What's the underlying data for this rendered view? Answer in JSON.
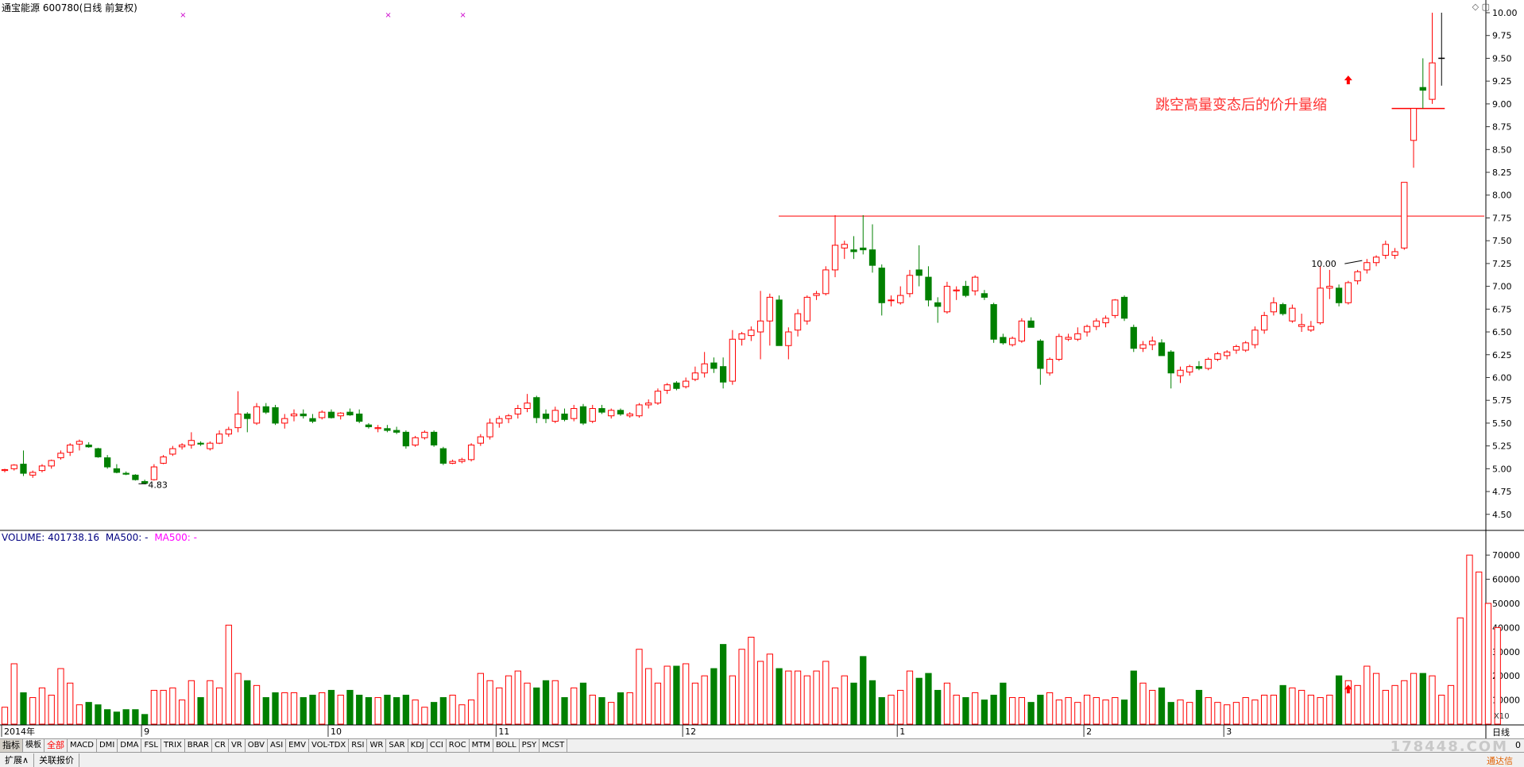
{
  "header": {
    "stock_title": "通宝能源 600780(日线 前复权)",
    "corner_icons": "◇ ▢"
  },
  "volume_header": {
    "label": "VOLUME: 401738.16",
    "ma1": "MA500: -",
    "ma2": "MA500: -"
  },
  "annotation": {
    "text": "跳空高量变态后的价升量缩",
    "color": "#ff3333"
  },
  "colors": {
    "up": "#ff0000",
    "down": "#008000",
    "resistance_line": "#ff0000",
    "axis": "#333333",
    "grid_line": "#000000",
    "marker_x": "#cc00cc"
  },
  "chart_data": [
    {
      "type": "candlestick",
      "title": "",
      "price_axis": {
        "ticks": [
          "10.00",
          "9.75",
          "9.50",
          "9.25",
          "9.00",
          "8.75",
          "8.50",
          "8.25",
          "8.00",
          "7.75",
          "7.50",
          "7.25",
          "7.00",
          "6.75",
          "6.50",
          "6.25",
          "6.00",
          "5.75",
          "5.50",
          "5.25",
          "5.00",
          "4.75",
          "4.50"
        ],
        "range": [
          4.35,
          10.0
        ]
      },
      "x_labels": [
        "2014年",
        "9",
        "10",
        "11",
        "12",
        "1",
        "2",
        "3"
      ],
      "x_label_positions": [
        0,
        15,
        35,
        53,
        73,
        96,
        116,
        131
      ],
      "annotations": [
        {
          "type": "low",
          "label": "4.83",
          "index": 14
        },
        {
          "type": "high",
          "label": "10.00",
          "index": 146
        }
      ],
      "resistance_level": 7.77,
      "small_bar_level": 8.95,
      "up_arrows": [
        144
      ],
      "x_markers": [
        19,
        41,
        49
      ],
      "candles": [
        [
          4.98,
          5.0,
          4.96,
          4.99
        ],
        [
          5.0,
          5.05,
          4.98,
          5.04
        ],
        [
          5.05,
          5.2,
          4.92,
          4.95
        ],
        [
          4.93,
          4.98,
          4.9,
          4.96
        ],
        [
          4.98,
          5.05,
          4.96,
          5.03
        ],
        [
          5.03,
          5.1,
          5.0,
          5.09
        ],
        [
          5.12,
          5.2,
          5.1,
          5.17
        ],
        [
          5.18,
          5.28,
          5.14,
          5.26
        ],
        [
          5.27,
          5.32,
          5.2,
          5.3
        ],
        [
          5.26,
          5.29,
          5.23,
          5.24
        ],
        [
          5.22,
          5.23,
          5.12,
          5.13
        ],
        [
          5.12,
          5.15,
          5.0,
          5.02
        ],
        [
          5.0,
          5.05,
          4.95,
          4.96
        ],
        [
          4.95,
          4.97,
          4.93,
          4.94
        ],
        [
          4.93,
          4.94,
          4.87,
          4.88
        ],
        [
          4.86,
          4.88,
          4.83,
          4.84
        ],
        [
          4.88,
          5.05,
          4.87,
          5.02
        ],
        [
          5.06,
          5.15,
          5.05,
          5.13
        ],
        [
          5.16,
          5.25,
          5.14,
          5.22
        ],
        [
          5.24,
          5.28,
          5.21,
          5.26
        ],
        [
          5.26,
          5.4,
          5.22,
          5.31
        ],
        [
          5.28,
          5.3,
          5.25,
          5.27
        ],
        [
          5.22,
          5.3,
          5.2,
          5.28
        ],
        [
          5.28,
          5.42,
          5.27,
          5.38
        ],
        [
          5.38,
          5.46,
          5.35,
          5.43
        ],
        [
          5.45,
          5.85,
          5.4,
          5.6
        ],
        [
          5.6,
          5.62,
          5.4,
          5.55
        ],
        [
          5.5,
          5.72,
          5.48,
          5.68
        ],
        [
          5.68,
          5.72,
          5.6,
          5.62
        ],
        [
          5.67,
          5.7,
          5.48,
          5.5
        ],
        [
          5.5,
          5.6,
          5.44,
          5.55
        ],
        [
          5.58,
          5.65,
          5.52,
          5.6
        ],
        [
          5.6,
          5.65,
          5.55,
          5.58
        ],
        [
          5.55,
          5.6,
          5.5,
          5.52
        ],
        [
          5.56,
          5.64,
          5.54,
          5.62
        ],
        [
          5.62,
          5.65,
          5.55,
          5.56
        ],
        [
          5.58,
          5.62,
          5.54,
          5.61
        ],
        [
          5.62,
          5.66,
          5.58,
          5.59
        ],
        [
          5.6,
          5.65,
          5.5,
          5.52
        ],
        [
          5.48,
          5.5,
          5.44,
          5.46
        ],
        [
          5.44,
          5.48,
          5.4,
          5.45
        ],
        [
          5.44,
          5.48,
          5.4,
          5.42
        ],
        [
          5.42,
          5.46,
          5.38,
          5.4
        ],
        [
          5.4,
          5.42,
          5.22,
          5.25
        ],
        [
          5.26,
          5.36,
          5.24,
          5.34
        ],
        [
          5.34,
          5.42,
          5.32,
          5.4
        ],
        [
          5.4,
          5.42,
          5.24,
          5.26
        ],
        [
          5.22,
          5.24,
          5.04,
          5.06
        ],
        [
          5.06,
          5.1,
          5.05,
          5.08
        ],
        [
          5.08,
          5.12,
          5.06,
          5.1
        ],
        [
          5.1,
          5.28,
          5.08,
          5.26
        ],
        [
          5.28,
          5.38,
          5.25,
          5.35
        ],
        [
          5.35,
          5.55,
          5.32,
          5.5
        ],
        [
          5.5,
          5.58,
          5.45,
          5.55
        ],
        [
          5.55,
          5.6,
          5.5,
          5.58
        ],
        [
          5.6,
          5.7,
          5.55,
          5.66
        ],
        [
          5.66,
          5.82,
          5.62,
          5.72
        ],
        [
          5.78,
          5.8,
          5.5,
          5.56
        ],
        [
          5.6,
          5.65,
          5.5,
          5.55
        ],
        [
          5.52,
          5.68,
          5.5,
          5.64
        ],
        [
          5.6,
          5.66,
          5.52,
          5.54
        ],
        [
          5.55,
          5.7,
          5.52,
          5.66
        ],
        [
          5.68,
          5.71,
          5.48,
          5.5
        ],
        [
          5.52,
          5.7,
          5.5,
          5.66
        ],
        [
          5.66,
          5.7,
          5.6,
          5.62
        ],
        [
          5.58,
          5.66,
          5.55,
          5.64
        ],
        [
          5.64,
          5.66,
          5.58,
          5.6
        ],
        [
          5.58,
          5.62,
          5.56,
          5.6
        ],
        [
          5.58,
          5.72,
          5.56,
          5.7
        ],
        [
          5.7,
          5.76,
          5.66,
          5.72
        ],
        [
          5.72,
          5.88,
          5.7,
          5.85
        ],
        [
          5.86,
          5.94,
          5.82,
          5.92
        ],
        [
          5.94,
          5.96,
          5.86,
          5.88
        ],
        [
          5.9,
          6.0,
          5.88,
          5.96
        ],
        [
          5.98,
          6.12,
          5.96,
          6.05
        ],
        [
          6.05,
          6.28,
          6.0,
          6.15
        ],
        [
          6.16,
          6.22,
          6.05,
          6.1
        ],
        [
          6.12,
          6.22,
          5.88,
          5.95
        ],
        [
          5.96,
          6.52,
          5.92,
          6.42
        ],
        [
          6.42,
          6.5,
          6.35,
          6.48
        ],
        [
          6.46,
          6.56,
          6.4,
          6.52
        ],
        [
          6.5,
          6.95,
          6.2,
          6.62
        ],
        [
          6.62,
          6.92,
          6.35,
          6.88
        ],
        [
          6.85,
          6.9,
          6.4,
          6.35
        ],
        [
          6.35,
          6.55,
          6.2,
          6.5
        ],
        [
          6.52,
          6.75,
          6.45,
          6.7
        ],
        [
          6.62,
          6.9,
          6.58,
          6.88
        ],
        [
          6.9,
          6.95,
          6.85,
          6.92
        ],
        [
          6.92,
          7.22,
          6.9,
          7.18
        ],
        [
          7.18,
          7.78,
          7.1,
          7.45
        ],
        [
          7.42,
          7.5,
          7.3,
          7.46
        ],
        [
          7.4,
          7.55,
          7.3,
          7.38
        ],
        [
          7.42,
          7.78,
          7.35,
          7.4
        ],
        [
          7.4,
          7.68,
          7.15,
          7.23
        ],
        [
          7.2,
          7.24,
          6.68,
          6.82
        ],
        [
          6.85,
          6.9,
          6.78,
          6.85
        ],
        [
          6.82,
          7.0,
          6.8,
          6.9
        ],
        [
          6.92,
          7.18,
          6.88,
          7.12
        ],
        [
          7.18,
          7.45,
          7.0,
          7.12
        ],
        [
          7.1,
          7.22,
          6.78,
          6.85
        ],
        [
          6.82,
          6.88,
          6.6,
          6.78
        ],
        [
          6.72,
          7.05,
          6.7,
          7.0
        ],
        [
          6.95,
          7.0,
          6.85,
          6.96
        ],
        [
          7.0,
          7.06,
          6.88,
          6.9
        ],
        [
          6.95,
          7.12,
          6.9,
          7.1
        ],
        [
          6.92,
          6.96,
          6.85,
          6.88
        ],
        [
          6.8,
          6.82,
          6.38,
          6.42
        ],
        [
          6.44,
          6.48,
          6.36,
          6.38
        ],
        [
          6.36,
          6.45,
          6.34,
          6.43
        ],
        [
          6.4,
          6.65,
          6.38,
          6.62
        ],
        [
          6.62,
          6.66,
          6.58,
          6.55
        ],
        [
          6.4,
          6.42,
          5.92,
          6.1
        ],
        [
          6.05,
          6.22,
          6.02,
          6.2
        ],
        [
          6.2,
          6.48,
          6.18,
          6.45
        ],
        [
          6.42,
          6.48,
          6.4,
          6.44
        ],
        [
          6.42,
          6.55,
          6.4,
          6.48
        ],
        [
          6.5,
          6.58,
          6.45,
          6.56
        ],
        [
          6.56,
          6.65,
          6.52,
          6.62
        ],
        [
          6.6,
          6.68,
          6.55,
          6.65
        ],
        [
          6.68,
          6.86,
          6.65,
          6.85
        ],
        [
          6.88,
          6.9,
          6.62,
          6.65
        ],
        [
          6.55,
          6.58,
          6.28,
          6.32
        ],
        [
          6.32,
          6.4,
          6.28,
          6.36
        ],
        [
          6.36,
          6.45,
          6.3,
          6.4
        ],
        [
          6.38,
          6.42,
          6.34,
          6.24
        ],
        [
          6.28,
          6.3,
          5.88,
          6.05
        ],
        [
          6.02,
          6.12,
          5.94,
          6.08
        ],
        [
          6.06,
          6.14,
          6.02,
          6.12
        ],
        [
          6.12,
          6.18,
          6.08,
          6.1
        ],
        [
          6.1,
          6.22,
          6.08,
          6.2
        ],
        [
          6.2,
          6.28,
          6.18,
          6.26
        ],
        [
          6.24,
          6.3,
          6.2,
          6.28
        ],
        [
          6.3,
          6.36,
          6.26,
          6.34
        ],
        [
          6.3,
          6.4,
          6.28,
          6.38
        ],
        [
          6.36,
          6.56,
          6.32,
          6.52
        ],
        [
          6.52,
          6.72,
          6.48,
          6.68
        ],
        [
          6.72,
          6.88,
          6.68,
          6.82
        ],
        [
          6.8,
          6.82,
          6.68,
          6.7
        ],
        [
          6.62,
          6.8,
          6.6,
          6.76
        ],
        [
          6.56,
          6.7,
          6.5,
          6.58
        ],
        [
          6.52,
          6.62,
          6.5,
          6.56
        ],
        [
          6.6,
          7.22,
          6.58,
          6.98
        ],
        [
          6.98,
          7.18,
          6.86,
          7.0
        ],
        [
          6.98,
          7.02,
          6.78,
          6.82
        ],
        [
          6.82,
          7.06,
          6.8,
          7.04
        ],
        [
          7.06,
          7.18,
          7.02,
          7.16
        ],
        [
          7.18,
          7.3,
          7.14,
          7.26
        ],
        [
          7.26,
          7.34,
          7.22,
          7.32
        ],
        [
          7.34,
          7.5,
          7.3,
          7.46
        ],
        [
          7.34,
          7.42,
          7.3,
          7.38
        ],
        [
          7.42,
          8.14,
          7.4,
          8.14
        ],
        [
          8.6,
          8.95,
          8.3,
          8.95
        ],
        [
          9.18,
          9.5,
          8.95,
          9.15
        ],
        [
          9.05,
          10.0,
          9.0,
          9.45
        ],
        [
          9.5,
          10.0,
          9.2,
          9.5
        ]
      ]
    },
    {
      "type": "bar",
      "title": "",
      "y_axis": {
        "ticks": [
          "70000",
          "60000",
          "50000",
          "40000",
          "30000",
          "20000",
          "10000"
        ],
        "range": [
          0,
          73000
        ]
      },
      "unit": "X10",
      "values": [
        7000,
        25000,
        13000,
        11000,
        15000,
        12000,
        23000,
        17000,
        8000,
        9000,
        8000,
        6000,
        5000,
        6000,
        6000,
        4000,
        14000,
        14000,
        15000,
        10000,
        18000,
        11000,
        18000,
        15000,
        41000,
        21000,
        18000,
        16000,
        11000,
        13000,
        13000,
        13000,
        11000,
        12000,
        13000,
        14000,
        12000,
        14000,
        12000,
        11000,
        11000,
        12000,
        11000,
        12000,
        10000,
        7000,
        9000,
        11000,
        12000,
        8000,
        10000,
        21000,
        18000,
        15000,
        20000,
        22000,
        17000,
        15000,
        18000,
        18000,
        11000,
        15000,
        17000,
        12000,
        11000,
        9000,
        13000,
        13000,
        31000,
        23000,
        17000,
        24000,
        24000,
        25000,
        17000,
        20000,
        23000,
        33000,
        20000,
        31000,
        36000,
        26000,
        29000,
        23000,
        22000,
        22000,
        20000,
        22000,
        26000,
        15000,
        20000,
        17000,
        28000,
        18000,
        11000,
        12000,
        14000,
        22000,
        19000,
        21000,
        14000,
        17000,
        12000,
        11000,
        13000,
        10000,
        12000,
        17000,
        11000,
        11000,
        9000,
        12000,
        13000,
        10000,
        11000,
        9000,
        12000,
        11000,
        10000,
        11000,
        10000,
        22000,
        17000,
        14000,
        15000,
        9000,
        10000,
        9000,
        14000,
        11000,
        9000,
        8000,
        9000,
        11000,
        10000,
        12000,
        12000,
        16000,
        15000,
        14000,
        12000,
        11000,
        12000,
        20000,
        18000,
        16000,
        24000,
        21000,
        14000,
        16000,
        18000,
        21000,
        21000,
        20000,
        12000,
        16000,
        44000,
        70000,
        63000,
        50000,
        40000
      ]
    }
  ],
  "tabs": [
    "指标",
    "模板",
    "全部",
    "MACD",
    "DMI",
    "DMA",
    "FSL",
    "TRIX",
    "BRAR",
    "CR",
    "VR",
    "OBV",
    "ASI",
    "EMV",
    "VOL-TDX",
    "RSI",
    "WR",
    "SAR",
    "KDJ",
    "CCI",
    "ROC",
    "MTM",
    "BOLL",
    "PSY",
    "MCST"
  ],
  "active_tab_index": 2,
  "bottom_tabs": [
    "扩展∧",
    "关联报价"
  ],
  "watermark": "178448.COM",
  "brand": "通达信",
  "zero_label": "0",
  "xaxis_right_label": "日线"
}
